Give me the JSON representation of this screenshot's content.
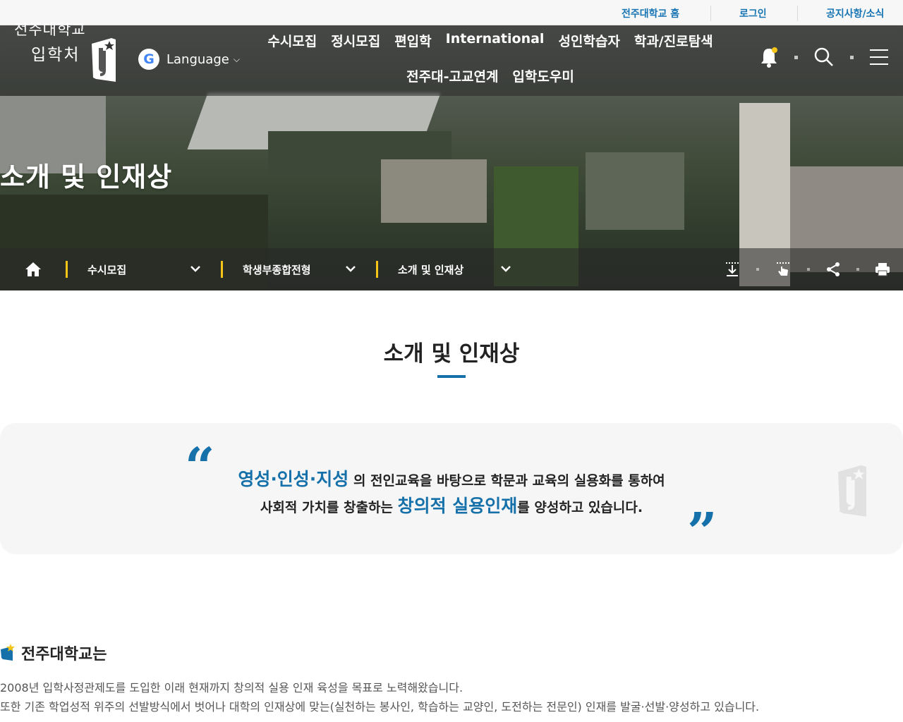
{
  "util_links": {
    "home": "전주대학교 홈",
    "login": "로그인",
    "notice": "공지사항/소식"
  },
  "logo": {
    "line1": "전주대학교",
    "line2": "입학처"
  },
  "language": {
    "icon": "google-icon",
    "label": "Language"
  },
  "gnb": {
    "row1": [
      "수시모집",
      "정시모집",
      "편입학",
      "International",
      "성인학습자",
      "학과/진로탐색"
    ],
    "row2": [
      "전주대-고교연계",
      "입학도우미"
    ]
  },
  "header_icons": [
    "bell-icon",
    "search-icon",
    "menu-icon"
  ],
  "hero": {
    "title": "소개 및 인재상"
  },
  "breadcrumb": {
    "home_icon": "home-icon",
    "items": [
      "수시모집",
      "학생부종합전형",
      "소개 및 인재상"
    ]
  },
  "tools": [
    "download-icon",
    "touch-icon",
    "share-icon",
    "print-icon"
  ],
  "page": {
    "title": "소개 및 인재상"
  },
  "quote": {
    "line1_hl": "영성·인성·지성",
    "line1_rest": "의 전인교육을 바탕으로 학문과 교육의 실용화를 통하여",
    "line2_pre": "사회적 가치를 창출하는",
    "line2_hl": "창의적 실용인재",
    "line2_post": "를 양성하고 있습니다."
  },
  "section": {
    "title": "전주대학교는",
    "para1": "2008년 입학사정관제도를 도입한 이래 현재까지 창의적 실용 인재 육성을 목표로 노력해왔습니다.",
    "para2": "또한 기존 학업성적 위주의 선발방식에서 벗어나 대학의 인재상에 맞는(실천하는 봉사인, 학습하는 교양인, 도전하는 전문인) 인재를 발굴·선발·양성하고 있습니다."
  },
  "colors": {
    "accent": "#1671aa",
    "link": "#1774b3",
    "crumb_bar": "#f5c518"
  }
}
